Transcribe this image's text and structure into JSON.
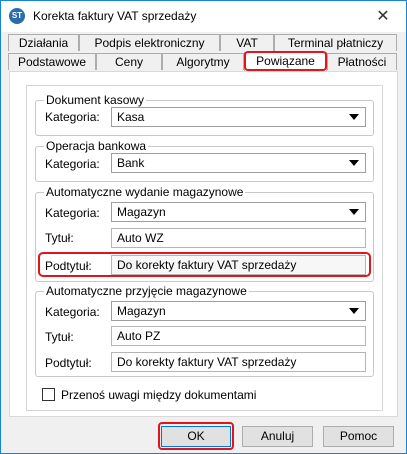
{
  "window": {
    "title": "Korekta faktury VAT sprzedaży",
    "icon_text": "ST",
    "close_glyph": "✕"
  },
  "tabs_row1": [
    {
      "label": "Działania"
    },
    {
      "label": "Podpis elektroniczny"
    },
    {
      "label": "VAT"
    },
    {
      "label": "Terminal płatniczy"
    }
  ],
  "tabs_row2": [
    {
      "label": "Podstawowe"
    },
    {
      "label": "Ceny"
    },
    {
      "label": "Algorytmy"
    },
    {
      "label": "Powiązane",
      "active": true
    },
    {
      "label": "Płatności"
    }
  ],
  "groups": {
    "dokument_kasowy": {
      "title": "Dokument kasowy",
      "kategoria_label": "Kategoria:",
      "kategoria_value": "Kasa"
    },
    "operacja_bankowa": {
      "title": "Operacja bankowa",
      "kategoria_label": "Kategoria:",
      "kategoria_value": "Bank"
    },
    "wydanie": {
      "title": "Automatyczne wydanie magazynowe",
      "kategoria_label": "Kategoria:",
      "kategoria_value": "Magazyn",
      "tytul_label": "Tytuł:",
      "tytul_value": "Auto WZ",
      "podtytul_label": "Podtytuł:",
      "podtytul_value": "Do korekty faktury VAT sprzedaży"
    },
    "przyjecie": {
      "title": "Automatyczne przyjęcie magazynowe",
      "kategoria_label": "Kategoria:",
      "kategoria_value": "Magazyn",
      "tytul_label": "Tytuł:",
      "tytul_value": "Auto PZ",
      "podtytul_label": "Podtytuł:",
      "podtytul_value": "Do korekty faktury VAT sprzedaży"
    }
  },
  "checkbox": {
    "label": "Przenoś uwagi między dokumentami",
    "checked": false
  },
  "buttons": {
    "ok": "OK",
    "cancel": "Anuluj",
    "help": "Pomoc"
  },
  "colors": {
    "highlight": "#e0161b",
    "window_border": "#1883d7"
  }
}
